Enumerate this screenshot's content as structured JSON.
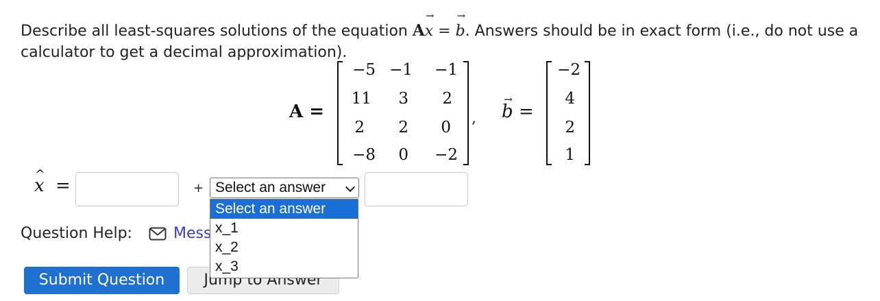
{
  "question": {
    "text_before": "Describe all least-squares solutions of the equation ",
    "eq_A": "A",
    "eq_x": "x",
    "eq_equals": " = ",
    "eq_b": "b",
    "text_after": ". Answers should be in exact form (i.e., do not use a calculator to get a decimal approximation)."
  },
  "matrix_A": {
    "label": "A =",
    "rows": [
      [
        "−5",
        "−1",
        "−1"
      ],
      [
        "11",
        "3",
        "2"
      ],
      [
        "2",
        "2",
        "0"
      ],
      [
        "−8",
        "0",
        "−2"
      ]
    ]
  },
  "separator": ",",
  "vector_b": {
    "label": "b",
    "equals": "=",
    "values": [
      "−2",
      "4",
      "2",
      "1"
    ]
  },
  "answer": {
    "xhat_label": "x",
    "xhat_equals": "=",
    "input1_value": "",
    "plus": "+",
    "select": {
      "selected": "Select an answer",
      "options": [
        "Select an answer",
        "x_1",
        "x_2",
        "x_3"
      ]
    },
    "input2_value": ""
  },
  "help": {
    "label": "Question Help:",
    "message_link": "Mess"
  },
  "buttons": {
    "submit": "Submit Question",
    "jump": "Jump to Answer"
  },
  "colors": {
    "accent": "#2070d0",
    "selected_option": "#1a6fd6",
    "link": "#3a3ad0"
  }
}
